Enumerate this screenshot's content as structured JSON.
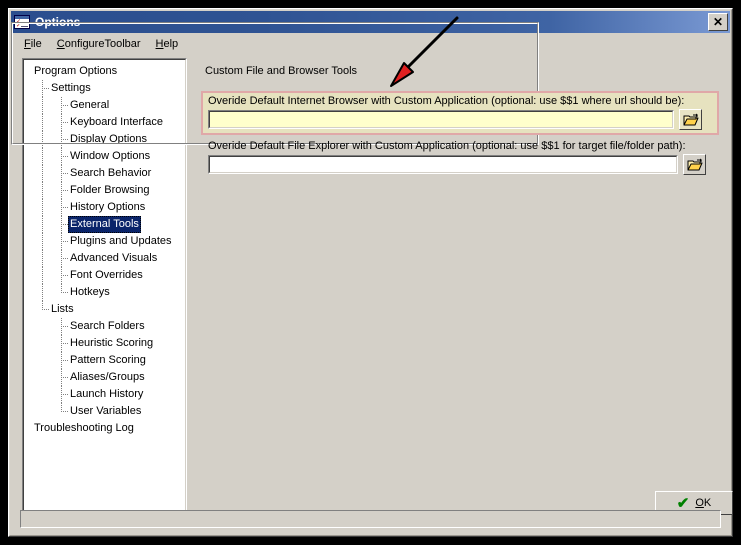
{
  "window": {
    "title": "Options",
    "icon": "options-checklist-icon",
    "close_label": "✕",
    "frame_color": "#d4d0c8",
    "titlebar_color": "#2f5393"
  },
  "menubar": {
    "items": [
      {
        "label": "File",
        "accel": "F"
      },
      {
        "label": "ConfigureToolbar",
        "accel": "C"
      },
      {
        "label": "Help",
        "accel": "H"
      }
    ]
  },
  "tree": {
    "selected": "External Tools",
    "selection_color": "#0a246a",
    "nodes": [
      {
        "label": "Program Options",
        "level": 0
      },
      {
        "label": "Settings",
        "level": 1
      },
      {
        "label": "General",
        "level": 2
      },
      {
        "label": "Keyboard Interface",
        "level": 2
      },
      {
        "label": "Display Options",
        "level": 2
      },
      {
        "label": "Window Options",
        "level": 2
      },
      {
        "label": "Search Behavior",
        "level": 2
      },
      {
        "label": "Folder Browsing",
        "level": 2
      },
      {
        "label": "History Options",
        "level": 2
      },
      {
        "label": "External Tools",
        "level": 2,
        "selected": true
      },
      {
        "label": "Plugins and Updates",
        "level": 2
      },
      {
        "label": "Advanced Visuals",
        "level": 2
      },
      {
        "label": "Font Overrides",
        "level": 2
      },
      {
        "label": "Hotkeys",
        "level": 2
      },
      {
        "label": "Lists",
        "level": 1
      },
      {
        "label": "Search Folders",
        "level": 2
      },
      {
        "label": "Heuristic Scoring",
        "level": 2
      },
      {
        "label": "Pattern Scoring",
        "level": 2
      },
      {
        "label": "Aliases/Groups",
        "level": 2
      },
      {
        "label": "Launch History",
        "level": 2
      },
      {
        "label": "User Variables",
        "level": 2
      },
      {
        "label": "Troubleshooting Log",
        "level": 0
      }
    ]
  },
  "groupbox": {
    "title": "Custom File and Browser Tools"
  },
  "browser_field": {
    "label": "Overide Default Internet Browser with Custom Application (optional: use $$1 where url should be):",
    "value": "",
    "placeholder": "",
    "highlight_background": "#ffffcc",
    "highlight_border": "#e0a8a8",
    "browse_icon": "open-folder-icon"
  },
  "explorer_field": {
    "label": "Overide Default File Explorer with Custom Application (optional: use $$1 for target file/folder path):",
    "value": "",
    "placeholder": "",
    "browse_icon": "open-folder-icon"
  },
  "ok_button": {
    "label": "OK",
    "accel": "O",
    "check_icon": "green-check-icon",
    "check_color": "#008000"
  },
  "annotation": {
    "type": "arrow",
    "line_color": "#000000",
    "head_color": "#e02020",
    "points_to": "browser-field-label"
  }
}
